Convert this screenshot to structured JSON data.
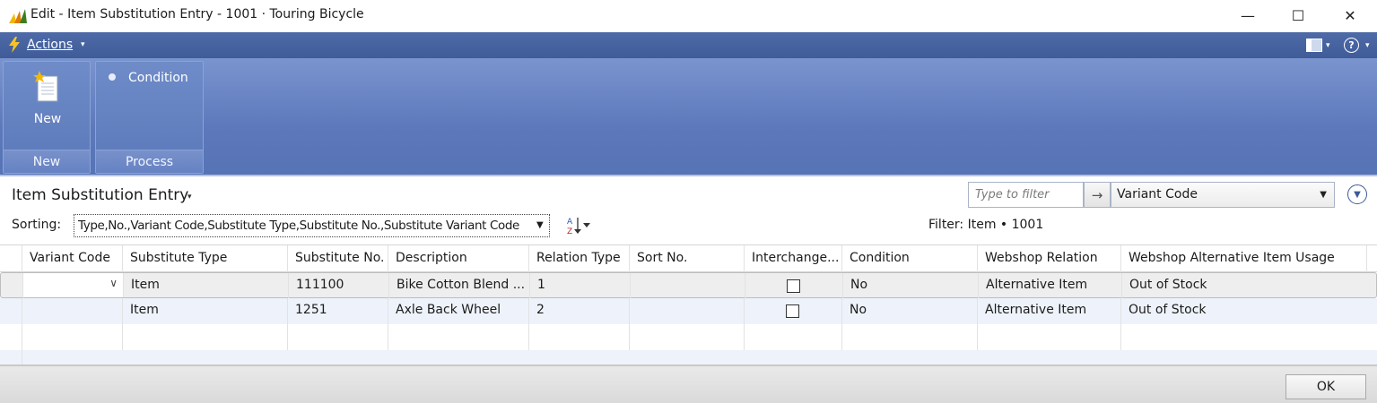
{
  "window": {
    "title": "Edit - Item Substitution Entry - 1001 · Touring Bicycle",
    "minimize_glyph": "—",
    "maximize_glyph": "☐",
    "close_glyph": "✕"
  },
  "actions_bar": {
    "actions_label": "Actions",
    "caret": "▾",
    "help_glyph": "?"
  },
  "ribbon": {
    "groups": [
      {
        "label": "New",
        "buttons": [
          {
            "label": "New",
            "icon": "new-document-icon"
          }
        ]
      },
      {
        "label": "Process",
        "buttons": [
          {
            "label": "Condition",
            "icon": "bullet-icon"
          }
        ]
      }
    ]
  },
  "page": {
    "title": "Item Substitution Entry",
    "title_caret": "▾",
    "sorting_label": "Sorting:",
    "sorting_value": "Type,No.,Variant Code,Substitute Type,Substitute No.,Substitute Variant Code",
    "sorting_caret": "▼",
    "filter_placeholder": "Type to filter",
    "filter_go": "→",
    "filter_field": "Variant Code",
    "filter_field_caret": "▼",
    "expand_glyph": "▼",
    "filter_summary": "Filter: Item • 1001"
  },
  "grid": {
    "columns": [
      "Variant Code",
      "Substitute Type",
      "Substitute No.",
      "Description",
      "Relation Type",
      "Sort No.",
      "Interchange...",
      "Condition",
      "Webshop Relation",
      "Webshop Alternative Item Usage"
    ],
    "rows": [
      {
        "variant_code": "",
        "substitute_type": "Item",
        "substitute_no": "111100",
        "description": "Bike Cotton Blend ...",
        "relation_type": "1",
        "sort_no": "",
        "interchangeable": false,
        "condition": "No",
        "webshop_relation": "Alternative Item",
        "webshop_usage": "Out of Stock"
      },
      {
        "variant_code": "",
        "substitute_type": "Item",
        "substitute_no": "1251",
        "description": "Axle Back Wheel",
        "relation_type": "2",
        "sort_no": "",
        "interchangeable": false,
        "condition": "No",
        "webshop_relation": "Alternative Item",
        "webshop_usage": "Out of Stock"
      }
    ],
    "dropdown_caret": "∨"
  },
  "footer": {
    "ok_label": "OK"
  },
  "colors": {
    "ribbon_blue": "#5d79bb",
    "actions_bar_blue": "#4e6ba8",
    "row_alt": "#eef3fb"
  }
}
